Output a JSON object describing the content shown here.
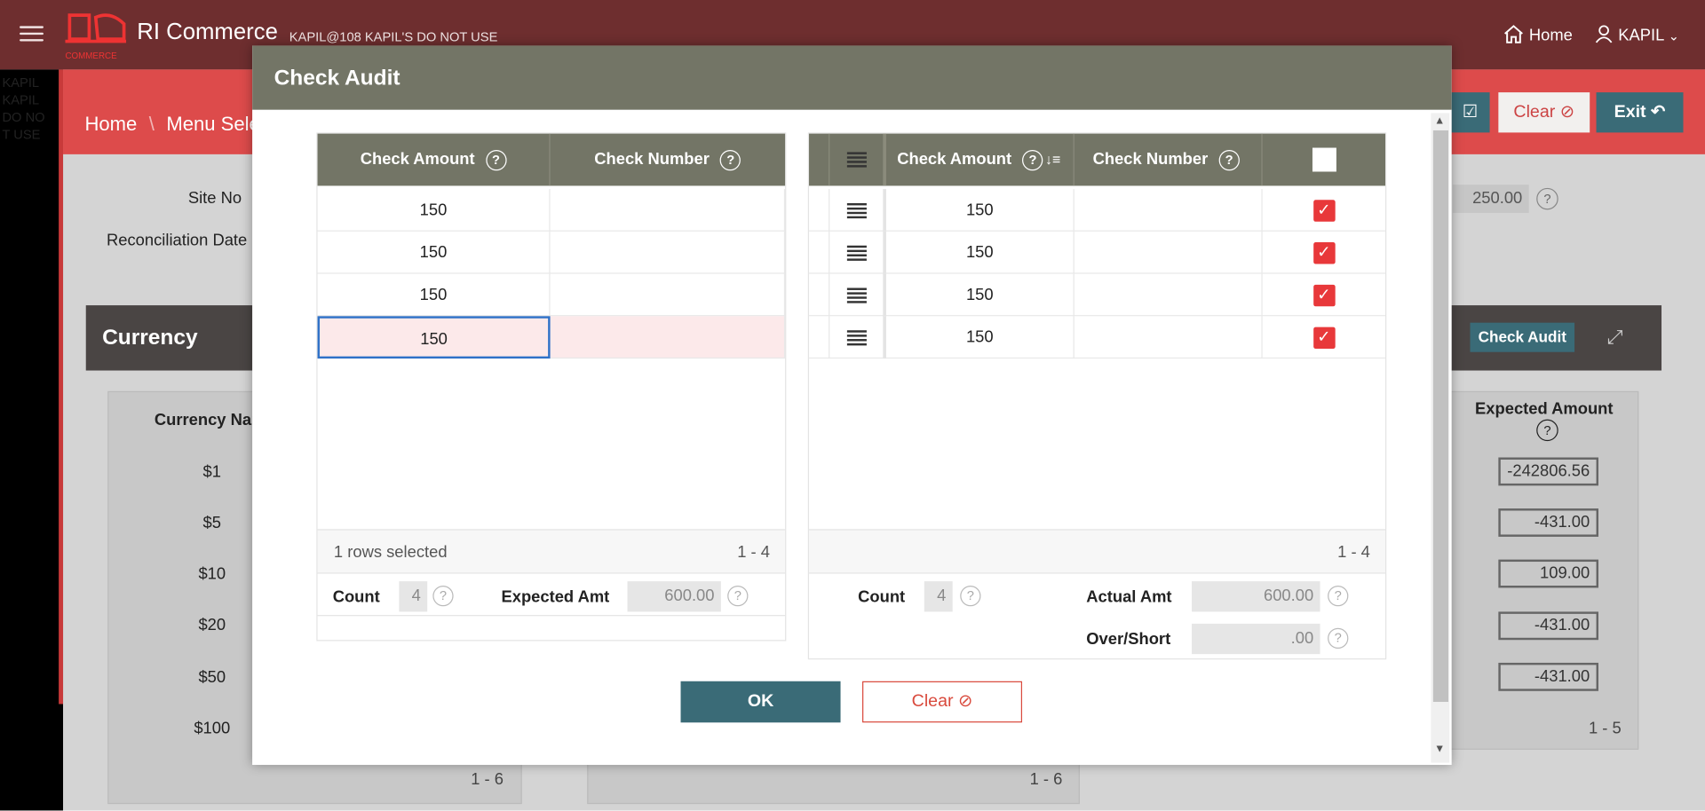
{
  "header": {
    "brand": "RI Commerce",
    "logo_caption": "COMMERCE",
    "subtitle": "KAPIL@108 KAPIL'S DO NOT USE",
    "home_label": "Home",
    "user_label": "KAPIL"
  },
  "sidebar": {
    "text": "KAPIL KAPIL DO NOT USE"
  },
  "breadcrumb": {
    "home": "Home",
    "sep": "\\",
    "current": "Menu Selec"
  },
  "toolbar": {
    "clear_label": "Clear",
    "exit_label": "Exit"
  },
  "form": {
    "site_no_label": "Site No",
    "recon_date_label": "Reconciliation Date",
    "right_value": "250.00"
  },
  "currency": {
    "title": "Currency",
    "check_audit_label": "Check Audit",
    "col_name": "Currency Nar",
    "col_expected": "Expected Amount",
    "names": [
      "$1",
      "$5",
      "$10",
      "$20",
      "$50",
      "$100"
    ],
    "expected": [
      "-242806.56",
      "-431.00",
      "109.00",
      "-431.00",
      "-431.00"
    ],
    "left_pagination": "1 - 6",
    "mid_pagination": "1 - 6",
    "right_pagination": "1 - 5"
  },
  "modal": {
    "title": "Check Audit",
    "left_grid": {
      "col_amount": "Check Amount",
      "col_number": "Check Number",
      "rows": [
        "150",
        "150",
        "150",
        "150"
      ],
      "selected_text": "1 rows selected",
      "pagination": "1 - 4",
      "count_label": "Count",
      "count_value": "4",
      "expected_label": "Expected Amt",
      "expected_value": "600.00"
    },
    "right_grid": {
      "col_amount": "Check Amount",
      "col_number": "Check Number",
      "rows": [
        "150",
        "150",
        "150",
        "150"
      ],
      "pagination": "1 - 4",
      "count_label": "Count",
      "count_value": "4",
      "actual_label": "Actual Amt",
      "actual_value": "600.00",
      "overshort_label": "Over/Short",
      "overshort_value": ".00"
    },
    "ok_label": "OK",
    "clear_label": "Clear"
  },
  "colors": {
    "header": "#6e2e2f",
    "accent_red": "#dd4b4b",
    "teal": "#3a6b77",
    "grid_header": "#737566",
    "checkbox": "#e8383a"
  }
}
